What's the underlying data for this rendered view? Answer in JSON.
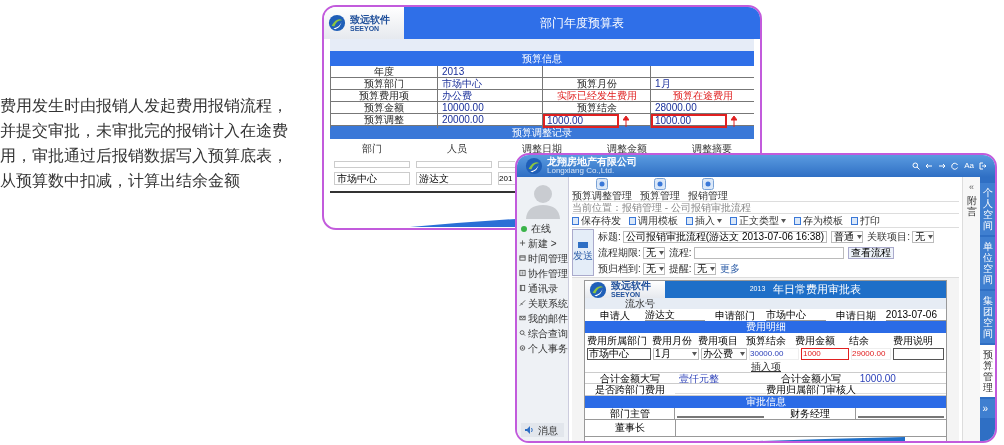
{
  "intro": "费用发生时由报销人发起费用报销流程，并提交审批，未审批完的报销计入在途费用，审批通过后报销数据写入预算底表，从预算数中扣减，计算出结余金额",
  "budget_sheet": {
    "logo": {
      "name": "致远软件",
      "latin": "SEEYON"
    },
    "title": "部门年度预算表",
    "info_section": "预算信息",
    "info_rows": [
      [
        {
          "text": "年度",
          "kind": "label"
        },
        {
          "text": "2013",
          "kind": "value"
        }
      ],
      [
        {
          "text": "预算部门",
          "kind": "label"
        },
        {
          "text": "市场中心",
          "kind": "value"
        },
        {
          "text": "预算月份",
          "kind": "label"
        },
        {
          "text": "1月",
          "kind": "value"
        }
      ],
      [
        {
          "text": "预算费用项",
          "kind": "label"
        },
        {
          "text": "办公费",
          "kind": "value"
        },
        {
          "text": "实际已经发生费用",
          "kind": "note"
        },
        {
          "text": "预算在途费用",
          "kind": "note"
        }
      ],
      [
        {
          "text": "预算金额",
          "kind": "label"
        },
        {
          "text": "10000.00",
          "kind": "value"
        },
        {
          "text": "预算结余",
          "kind": "label"
        },
        {
          "text": "28000.00",
          "kind": "value"
        }
      ],
      [
        {
          "text": "预算调整",
          "kind": "label"
        },
        {
          "text": "20000.00",
          "kind": "value"
        },
        {
          "text": "1000.00",
          "kind": "highlight"
        },
        {
          "text": "1000.00",
          "kind": "highlight"
        }
      ]
    ],
    "adjust_section": "预算调整记录",
    "adjust_columns": [
      "部门",
      "人员",
      "调整日期",
      "调整金额",
      "调整摘要"
    ],
    "adjust_row": [
      "市场中心",
      "游达文",
      "201"
    ]
  },
  "approval_window": {
    "company": "龙翔房地产有限公司",
    "company_en": "Longxiang Co.,Ltd.",
    "header_text": "Aa",
    "sidebar": {
      "status": "在线",
      "items": [
        "新建 >",
        "时间管理",
        "协作管理",
        "通讯录",
        "关联系统",
        "我的邮件",
        "综合查询",
        "个人事务"
      ],
      "message": "消息"
    },
    "modules": [
      "预算调整管理",
      "预算管理",
      "报销管理"
    ],
    "breadcrumb": "当前位置：报销管理 - 公司报销审批流程",
    "actions": [
      {
        "label": "保存待发",
        "dropdown": false
      },
      {
        "label": "调用模板",
        "dropdown": false
      },
      {
        "label": "插入",
        "dropdown": true
      },
      {
        "label": "正文类型",
        "dropdown": true
      },
      {
        "label": "存为模板",
        "dropdown": false
      },
      {
        "label": "打印",
        "dropdown": false
      }
    ],
    "send_button": "发送",
    "fields": [
      {
        "label": "标题:",
        "value": "公司报销审批流程(游达文 2013-07-06 16:38)",
        "kind": "text"
      },
      {
        "value": "普通",
        "kind": "select"
      },
      {
        "label": "关联项目:",
        "value": "无",
        "kind": "select"
      },
      {
        "label": "流程期限:",
        "value": "无",
        "kind": "select"
      },
      {
        "label": "流程:",
        "kind": "text"
      },
      {
        "label": "查看流程",
        "kind": "button"
      },
      {
        "label": "预归档到:",
        "value": "无",
        "kind": "select"
      },
      {
        "label": "提醒:",
        "value": "无",
        "kind": "select"
      },
      {
        "label": "更多",
        "kind": "link"
      }
    ],
    "form": {
      "logo": {
        "name": "致远软件",
        "latin": "SEEYON"
      },
      "year": "2013",
      "title": "年日常费用审批表",
      "serial_label": "流水号",
      "applicant": [
        {
          "label": "申请人",
          "value": "游达文"
        },
        {
          "label": "申请部门",
          "value": "市场中心"
        },
        {
          "label": "申请日期",
          "value": "2013-07-06"
        }
      ],
      "detail_section": "费用明细",
      "detail_columns": [
        "费用所属部门",
        "费用月份",
        "费用项目",
        "预算结余",
        "费用金额",
        "结余",
        "费用说明"
      ],
      "detail_row": [
        {
          "text": "市场中心",
          "kind": "input"
        },
        {
          "text": "1月",
          "kind": "select"
        },
        {
          "text": "办公费",
          "kind": "select"
        },
        {
          "text": "30000.00",
          "kind": "amount"
        },
        {
          "text": "1000",
          "kind": "highlight"
        },
        {
          "text": "29000.00",
          "kind": "warning"
        },
        {
          "kind": "input"
        }
      ],
      "insert_link": "插入项",
      "totals": [
        {
          "label": "合计金额大写",
          "value": "壹仟元整"
        },
        {
          "label": "合计金额小写",
          "value": "1000.00"
        }
      ],
      "cross_dept": [
        "是否跨部门费用",
        "费用归属部门审核人"
      ],
      "approval_section": "审批信息",
      "approvers": [
        "部门主管",
        "财务经理"
      ],
      "chairman": "董事长"
    },
    "side_panel": {
      "collapse": "«",
      "label": "附言"
    },
    "rail": [
      {
        "label": "个人空间",
        "selected": false
      },
      {
        "label": "单位空间",
        "selected": false
      },
      {
        "label": "集团空间",
        "selected": false
      },
      {
        "label": "预算管理",
        "selected": true
      },
      {
        "label": "»",
        "selected": false
      }
    ]
  }
}
